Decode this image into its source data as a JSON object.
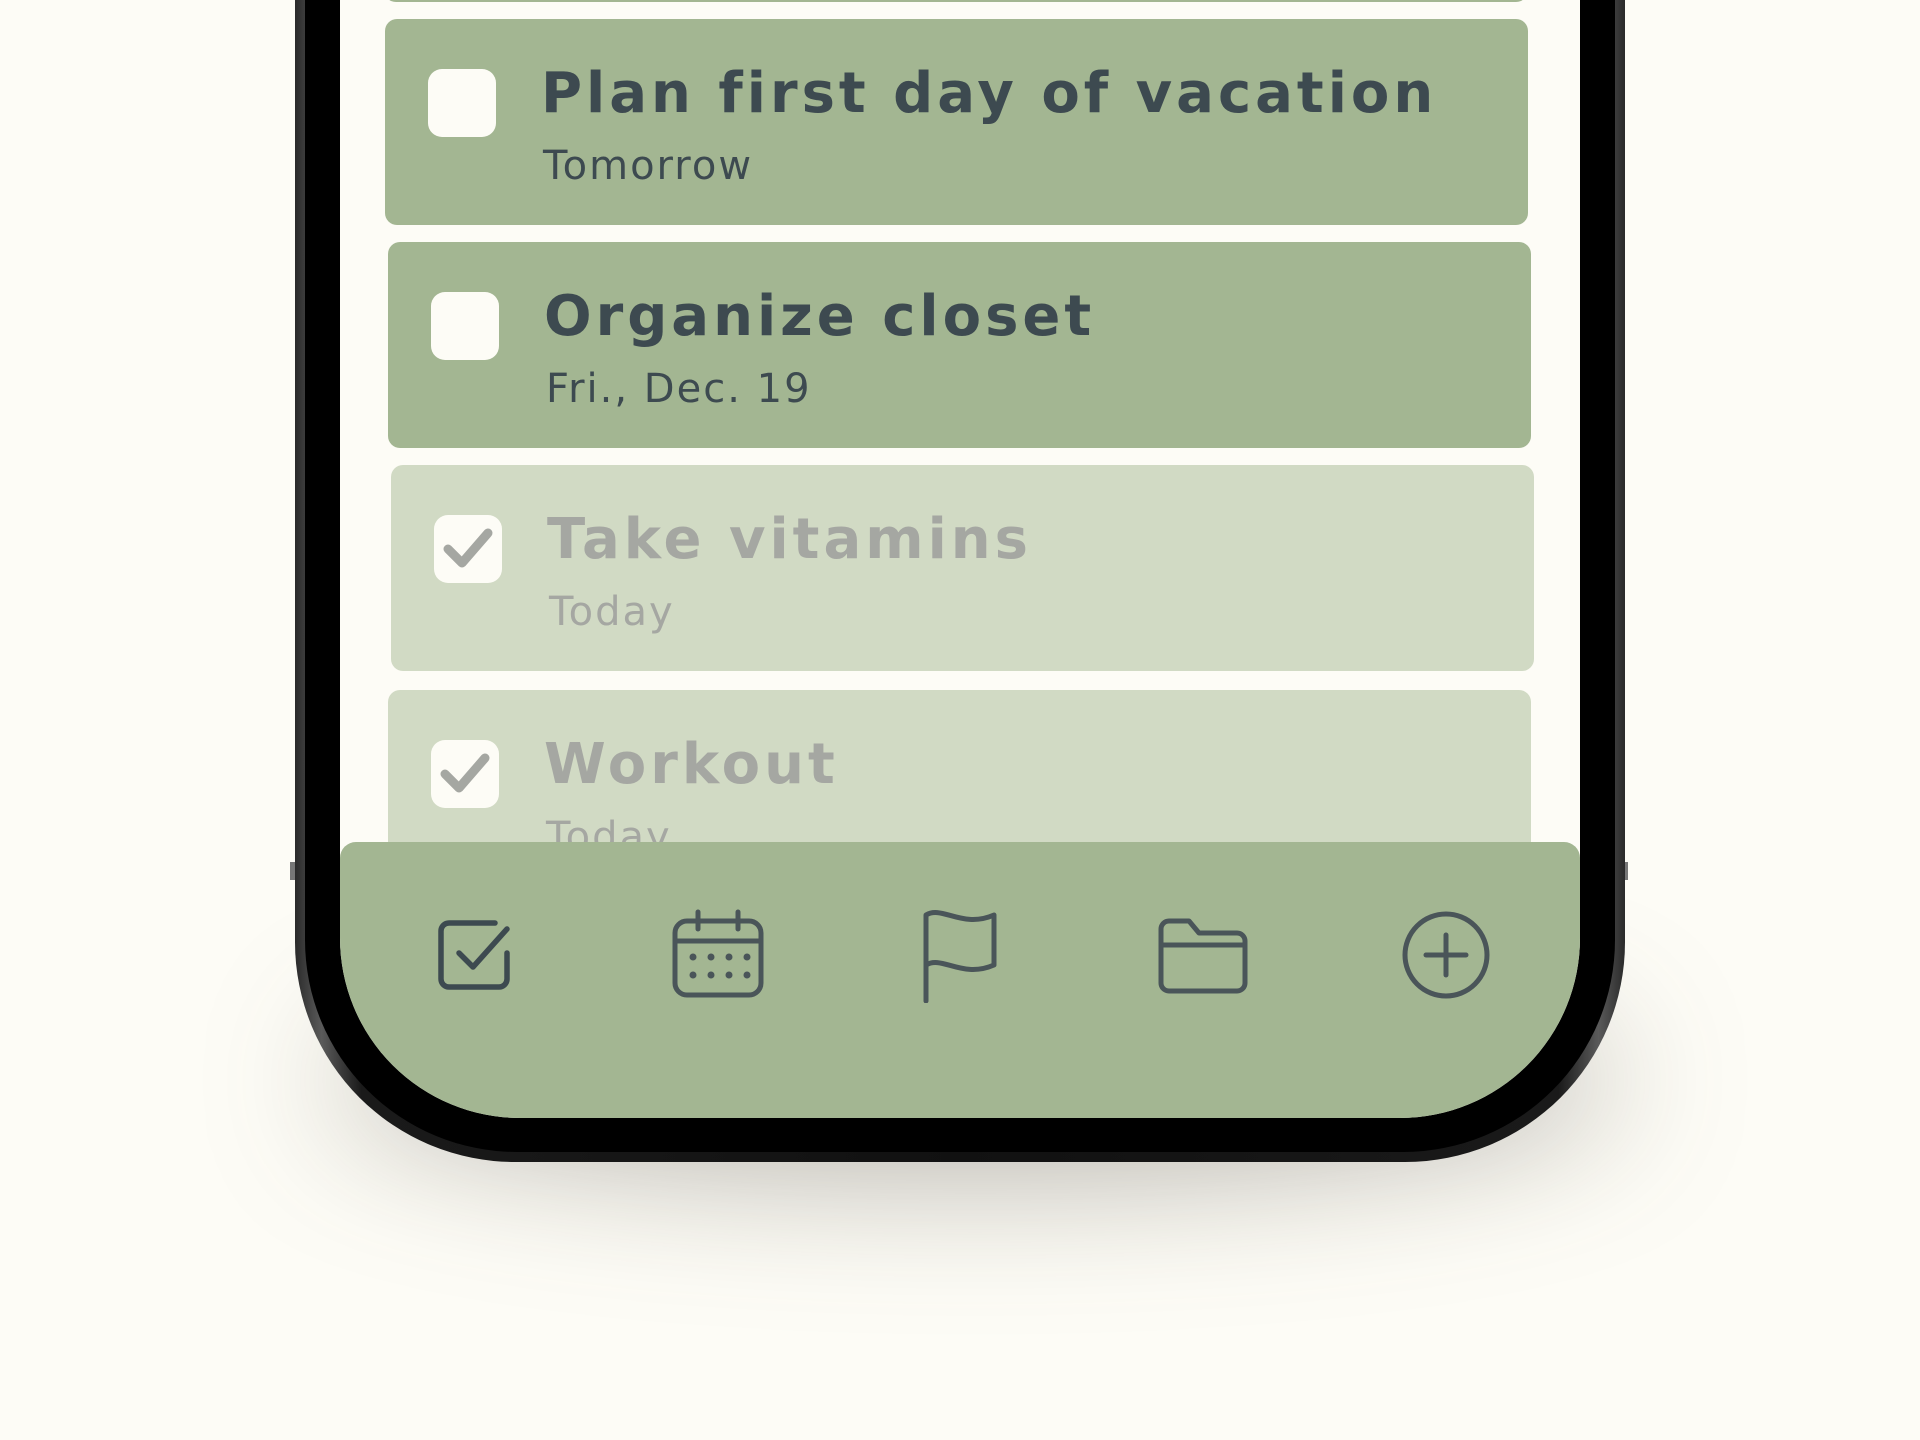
{
  "tasks": [
    {
      "title": "Plan first day of vacation",
      "date": "Tomorrow",
      "completed": false
    },
    {
      "title": "Organize closet",
      "date": "Fri., Dec. 19",
      "completed": false
    },
    {
      "title": "Take vitamins",
      "date": "Today",
      "completed": true
    },
    {
      "title": "Workout",
      "date": "Today",
      "completed": true
    }
  ],
  "tabbar": {
    "items": [
      {
        "id": "tasks",
        "icon": "checkbox-check-icon"
      },
      {
        "id": "calendar",
        "icon": "calendar-icon"
      },
      {
        "id": "flagged",
        "icon": "flag-icon"
      },
      {
        "id": "folders",
        "icon": "folder-icon"
      },
      {
        "id": "add",
        "icon": "plus-circle-icon"
      }
    ]
  },
  "colors": {
    "background": "#fdfcf6",
    "card": "#a3b692",
    "card_done": "#d1dac4",
    "text": "#3d4a50",
    "text_done": "#a5a7a2",
    "tabbar": "#a3b692"
  }
}
